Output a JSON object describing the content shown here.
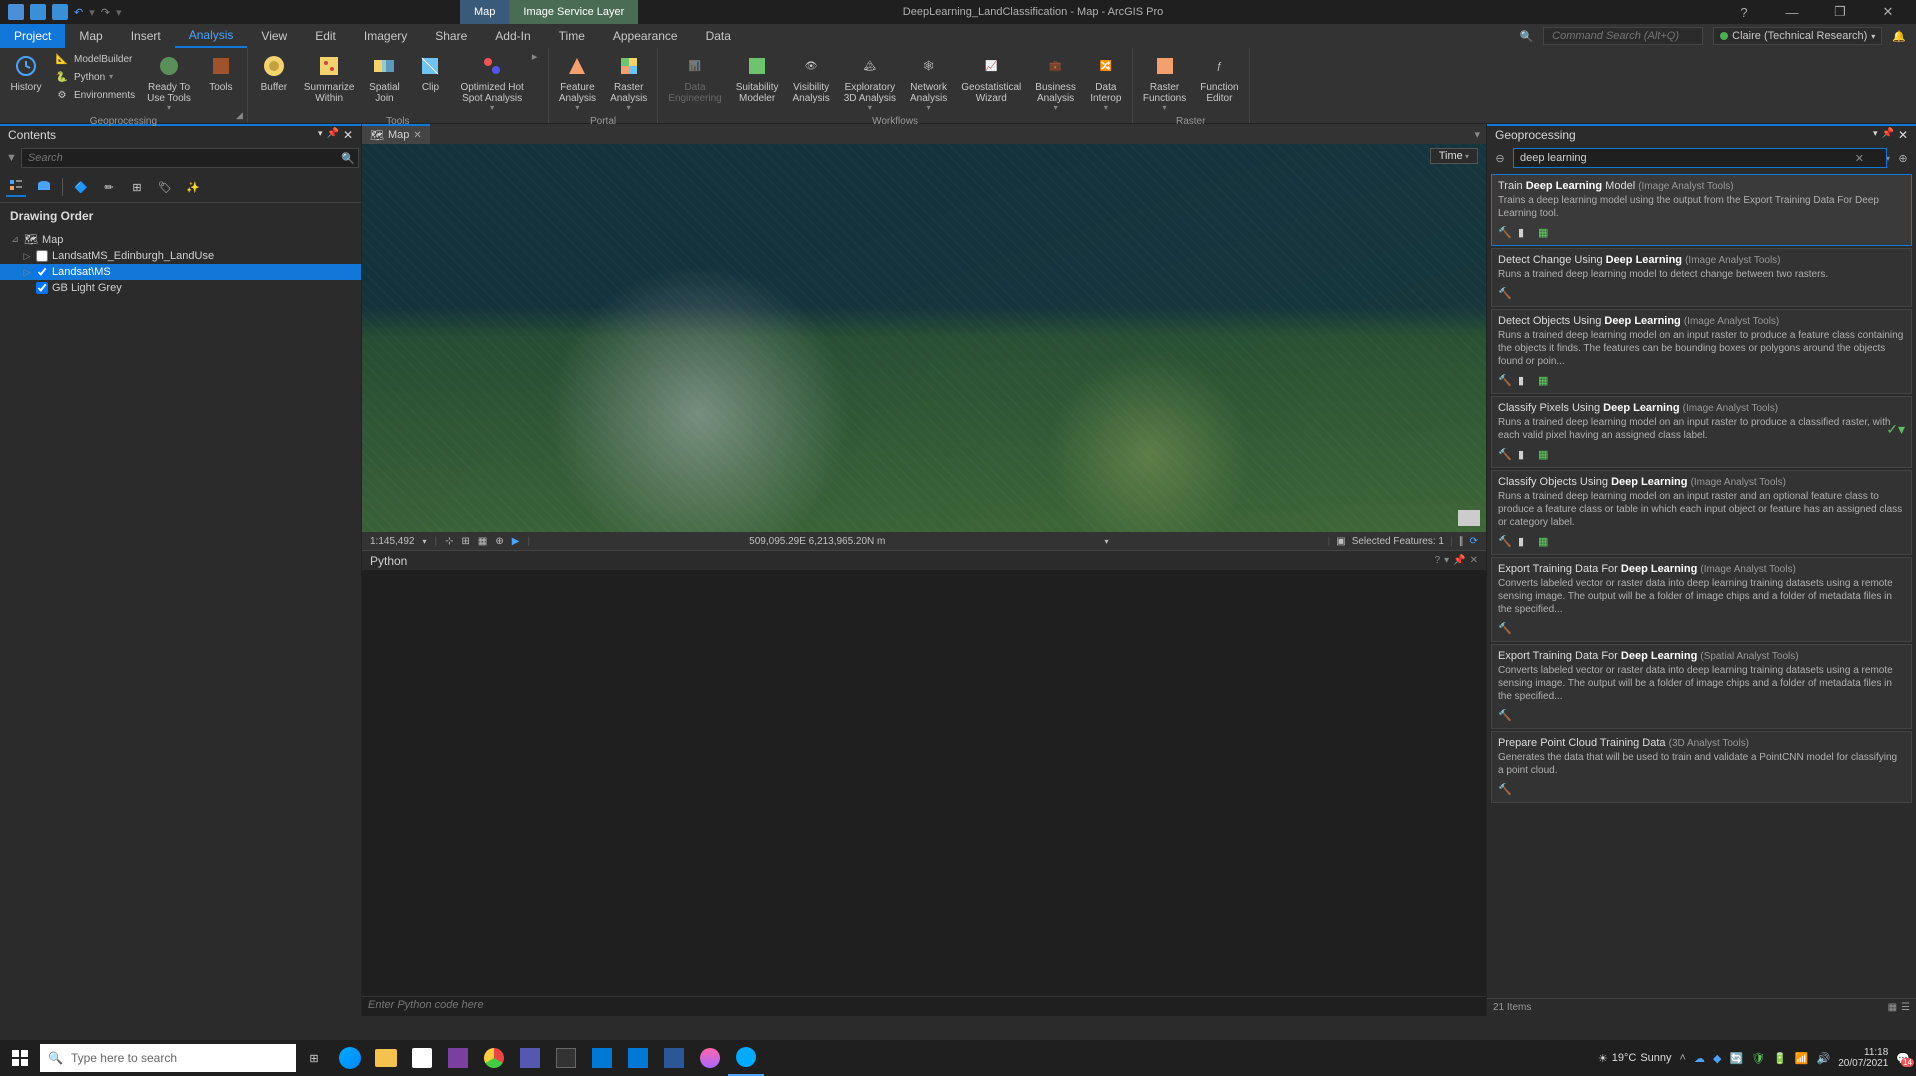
{
  "app": {
    "title": "DeepLearning_LandClassification - Map - ArcGIS Pro",
    "context_tabs": [
      "Map",
      "Image Service Layer"
    ]
  },
  "window": {
    "help": "?",
    "min": "—",
    "max": "❐",
    "close": "✕"
  },
  "ribbon_search": {
    "placeholder": "Command Search (Alt+Q)"
  },
  "user": {
    "name": "Claire (Technical Research)"
  },
  "ribbon_tabs": [
    "Project",
    "Map",
    "Insert",
    "View",
    "Edit",
    "Imagery",
    "Share",
    "Add-In",
    "Time",
    "Appearance",
    "Data"
  ],
  "ribbon_tabs_active": "Analysis",
  "ribbon": {
    "geoprocessing": {
      "label": "Geoprocessing",
      "history": "History",
      "items": [
        "ModelBuilder",
        "Python",
        "Environments"
      ],
      "ready": "Ready To\nUse Tools",
      "tools": "Tools"
    },
    "tools": {
      "label": "Tools",
      "items": [
        "Buffer",
        "Summarize\nWithin",
        "Spatial\nJoin",
        "Clip",
        "Optimized Hot\nSpot Analysis"
      ]
    },
    "portal": {
      "label": "Portal",
      "items": [
        "Feature\nAnalysis",
        "Raster\nAnalysis"
      ]
    },
    "workflows": {
      "label": "Workflows",
      "items": [
        "Data\nEngineering",
        "Suitability\nModeler",
        "Visibility\nAnalysis",
        "Exploratory\n3D Analysis",
        "Network\nAnalysis",
        "Geostatistical\nWizard",
        "Business\nAnalysis",
        "Data\nInterop"
      ]
    },
    "raster": {
      "label": "Raster",
      "items": [
        "Raster\nFunctions",
        "Function\nEditor"
      ]
    }
  },
  "contents": {
    "title": "Contents",
    "search_placeholder": "Search",
    "section": "Drawing Order",
    "map_label": "Map",
    "layers": [
      {
        "name": "LandsatMS_Edinburgh_LandUse",
        "checked": false
      },
      {
        "name": "Landsat\\MS",
        "checked": true,
        "selected": true
      },
      {
        "name": "GB Light Grey",
        "checked": true
      }
    ]
  },
  "map": {
    "tab": "Map",
    "time_btn": "Time",
    "scale": "1:145,492",
    "coords": "509,095.29E 6,213,965.20N m",
    "selected": "Selected Features: 1"
  },
  "gp": {
    "title": "Geoprocessing",
    "search_value": "deep learning",
    "footer": "21 Items",
    "tools": [
      {
        "prefix": "Train ",
        "bold": "Deep Learning",
        "suffix": " Model",
        "cat": "(Image Analyst Tools)",
        "desc": "Trains a deep learning model using the output from the Export Training Data For Deep Learning tool.",
        "selected": true,
        "icons": 3
      },
      {
        "prefix": "Detect Change Using ",
        "bold": "Deep Learning",
        "suffix": "",
        "cat": "(Image Analyst Tools)",
        "desc": "Runs a trained deep learning model to detect change between two rasters.",
        "icons": 1
      },
      {
        "prefix": "Detect Objects Using ",
        "bold": "Deep Learning",
        "suffix": "",
        "cat": "(Image Analyst Tools)",
        "desc": "Runs a trained deep learning model on an input raster to produce a feature class containing the objects it finds. The features can be bounding boxes or polygons around the objects found or poin...",
        "icons": 3
      },
      {
        "prefix": "Classify Pixels Using ",
        "bold": "Deep Learning",
        "suffix": "",
        "cat": "(Image Analyst Tools)",
        "desc": "Runs a trained deep learning model on an input raster to produce a classified raster, with each valid pixel having an assigned class label.",
        "icons": 3,
        "check": true
      },
      {
        "prefix": "Classify Objects Using ",
        "bold": "Deep Learning",
        "suffix": "",
        "cat": "(Image Analyst Tools)",
        "desc": "Runs a trained deep learning model on an input raster and an optional feature class to produce a feature class or table in which each input object or feature has an assigned class or category label.",
        "icons": 3
      },
      {
        "prefix": "Export Training Data For ",
        "bold": "Deep Learning",
        "suffix": "",
        "cat": "(Image Analyst Tools)",
        "desc": "Converts labeled vector or raster data into deep learning training datasets using a remote sensing image. The output will be a folder of image chips and a folder of metadata files in the specified...",
        "icons": 1
      },
      {
        "prefix": "Export Training Data For ",
        "bold": "Deep Learning",
        "suffix": "",
        "cat": "(Spatial Analyst Tools)",
        "desc": "Converts labeled vector or raster data into deep learning training datasets using a remote sensing image. The output will be a folder of image chips and a folder of metadata files in the specified...",
        "icons": 1
      },
      {
        "prefix": "Prepare Point Cloud Training Data",
        "bold": "",
        "suffix": "",
        "cat": "(3D Analyst Tools)",
        "desc": "Generates the data that will be used to train and validate\na PointCNN model for classifying a point cloud.",
        "icons": 1
      }
    ]
  },
  "python": {
    "title": "Python",
    "input_placeholder": "Enter Python code here"
  },
  "taskbar": {
    "search_placeholder": "Type here to search",
    "weather_temp": "19°C",
    "weather_cond": "Sunny",
    "time": "11:18",
    "date": "20/07/2021",
    "notif": "14"
  }
}
